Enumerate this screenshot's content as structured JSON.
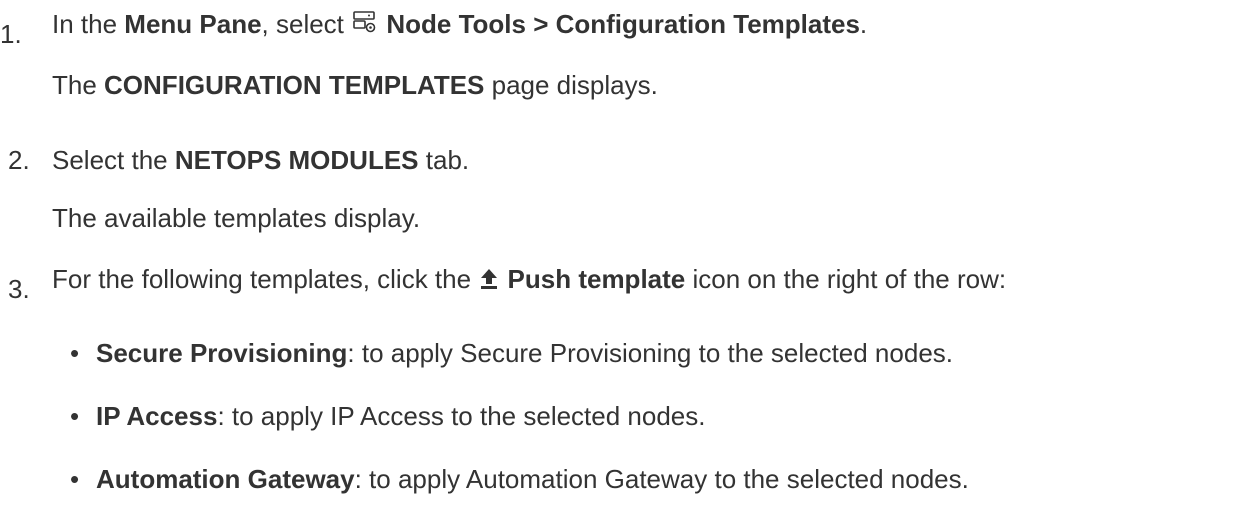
{
  "steps": [
    {
      "number": "1.",
      "parts": [
        "In the ",
        "Menu Pane",
        ", select ",
        "Node Tools > Configuration Templates",
        "."
      ],
      "icon": "node-tools-icon",
      "result": [
        "The ",
        "CONFIGURATION TEMPLATES",
        " page displays."
      ]
    },
    {
      "number": "2.",
      "parts": [
        "Select the ",
        "NETOPS MODULES",
        " tab."
      ],
      "result": [
        "The available templates display."
      ]
    },
    {
      "number": "3.",
      "parts": [
        "For the following templates, click the ",
        "Push template",
        " icon on the right of the row:"
      ],
      "icon": "push-template-icon",
      "bullets": [
        {
          "bullet": "•",
          "term": "Secure Provisioning",
          "desc": ": to apply Secure Provisioning to the selected nodes."
        },
        {
          "bullet": "•",
          "term": "IP Access",
          "desc": ": to apply IP Access to the selected nodes."
        },
        {
          "bullet": "•",
          "term": "Automation Gateway",
          "desc": ": to apply Automation Gateway to the selected nodes."
        }
      ]
    }
  ],
  "colors": {
    "text": "#333333",
    "background": "#ffffff"
  }
}
